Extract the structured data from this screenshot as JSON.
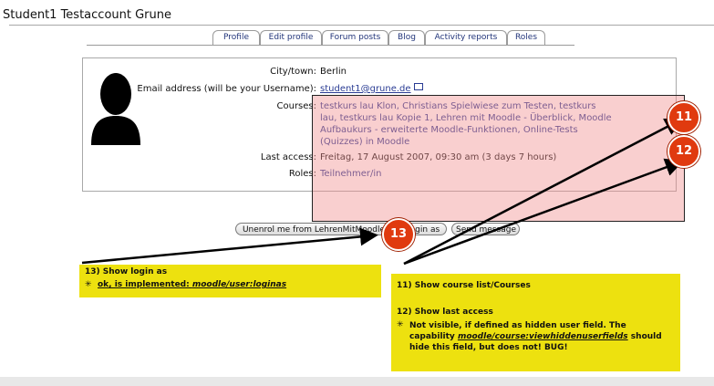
{
  "page": {
    "title": "Student1 Testaccount Grune"
  },
  "tabs": [
    "Profile",
    "Edit profile",
    "Forum posts",
    "Blog",
    "Activity reports",
    "Roles"
  ],
  "profile": {
    "city_label": "City/town:",
    "city_value": "Berlin",
    "email_label": "Email address (will be your Username):",
    "email_value": "student1@grune.de",
    "courses_label": "Courses:",
    "courses_lines": [
      "testkurs lau Klon, Christians Spielwiese zum Testen, testkurs",
      "lau, testkurs lau Kopie 1, Lehren mit Moodle - Überblick, Moodle",
      "Aufbaukurs - erweiterte Moodle-Funktionen, Online-Tests",
      "(Quizzes) in Moodle"
    ],
    "last_access_label": "Last access:",
    "last_access_value": "Freitag, 17 August 2007, 09:30 am  (3 days 7 hours)",
    "roles_label": "Roles:",
    "roles_value": "Teilnehmer/in"
  },
  "buttons": {
    "unenrol": "Unenrol me from LehrenMitMoodle",
    "login_as": "Login as",
    "send_message": "Send message"
  },
  "badges": {
    "b11": "11",
    "b12": "12",
    "b13": "13"
  },
  "note_left": {
    "title": "13) Show login as",
    "bullet_prefix": "ok, is implemented: ",
    "bullet_cap": "moodle/user:loginas"
  },
  "note_right": {
    "item11": "11) Show course list/Courses",
    "item12": "12) Show last access",
    "bullet_line1": "Not visible, if defined as hidden user field. The",
    "bullet_cap_prefix": "capability ",
    "bullet_cap": "moodle/course:viewhiddenuserfields",
    "bullet_cap_suffix": " should",
    "bullet_line3": "hide this field, but does not! BUG!"
  },
  "colors": {
    "highlight": "#f08c8c",
    "badge": "#e03a0f",
    "note": "#ede10f",
    "link": "#2a3c94"
  }
}
